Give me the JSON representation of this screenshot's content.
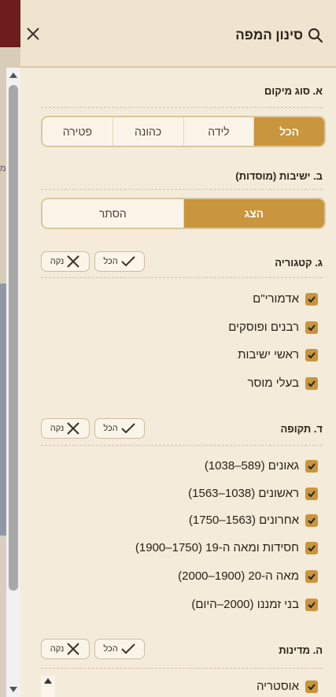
{
  "map": {
    "edge_text": "מ"
  },
  "panel": {
    "title": "סינון המפה",
    "sections": {
      "location_type": {
        "title": "א. סוג מיקום",
        "options": [
          "הכל",
          "לידה",
          "כהונה",
          "פטירה"
        ],
        "selected": "הכל"
      },
      "yeshivot": {
        "title": "ב. ישיבות (מוסדות)",
        "options": [
          "הצג",
          "הסתר"
        ],
        "selected": "הצג"
      },
      "category": {
        "title": "ג. קטגוריה",
        "all_label": "הכל",
        "clear_label": "נקה",
        "items": [
          {
            "label": "אדמורי\"ם",
            "checked": true
          },
          {
            "label": "רבנים ופוסקים",
            "checked": true
          },
          {
            "label": "ראשי ישיבות",
            "checked": true
          },
          {
            "label": "בעלי מוסר",
            "checked": true
          }
        ]
      },
      "period": {
        "title": "ד. תקופה",
        "all_label": "הכל",
        "clear_label": "נקה",
        "items": [
          {
            "label": "גאונים (589–1038)",
            "checked": true
          },
          {
            "label": "ראשונים (1038–1563)",
            "checked": true
          },
          {
            "label": "אחרונים (1563–1750)",
            "checked": true
          },
          {
            "label": "חסידות ומאה ה-19 (1750–1900)",
            "checked": true
          },
          {
            "label": "מאה ה-20 (1900–2000)",
            "checked": true
          },
          {
            "label": "בני זמננו (2000–היום)",
            "checked": true
          }
        ]
      },
      "country": {
        "title": "ה. מדינות",
        "all_label": "הכל",
        "clear_label": "נקה",
        "items": [
          {
            "label": "אוסטריה",
            "checked": true
          }
        ]
      }
    }
  },
  "colors": {
    "accent": "#c9953d",
    "panel_bg": "#f4ebda",
    "header_bg": "#efe4cf"
  }
}
